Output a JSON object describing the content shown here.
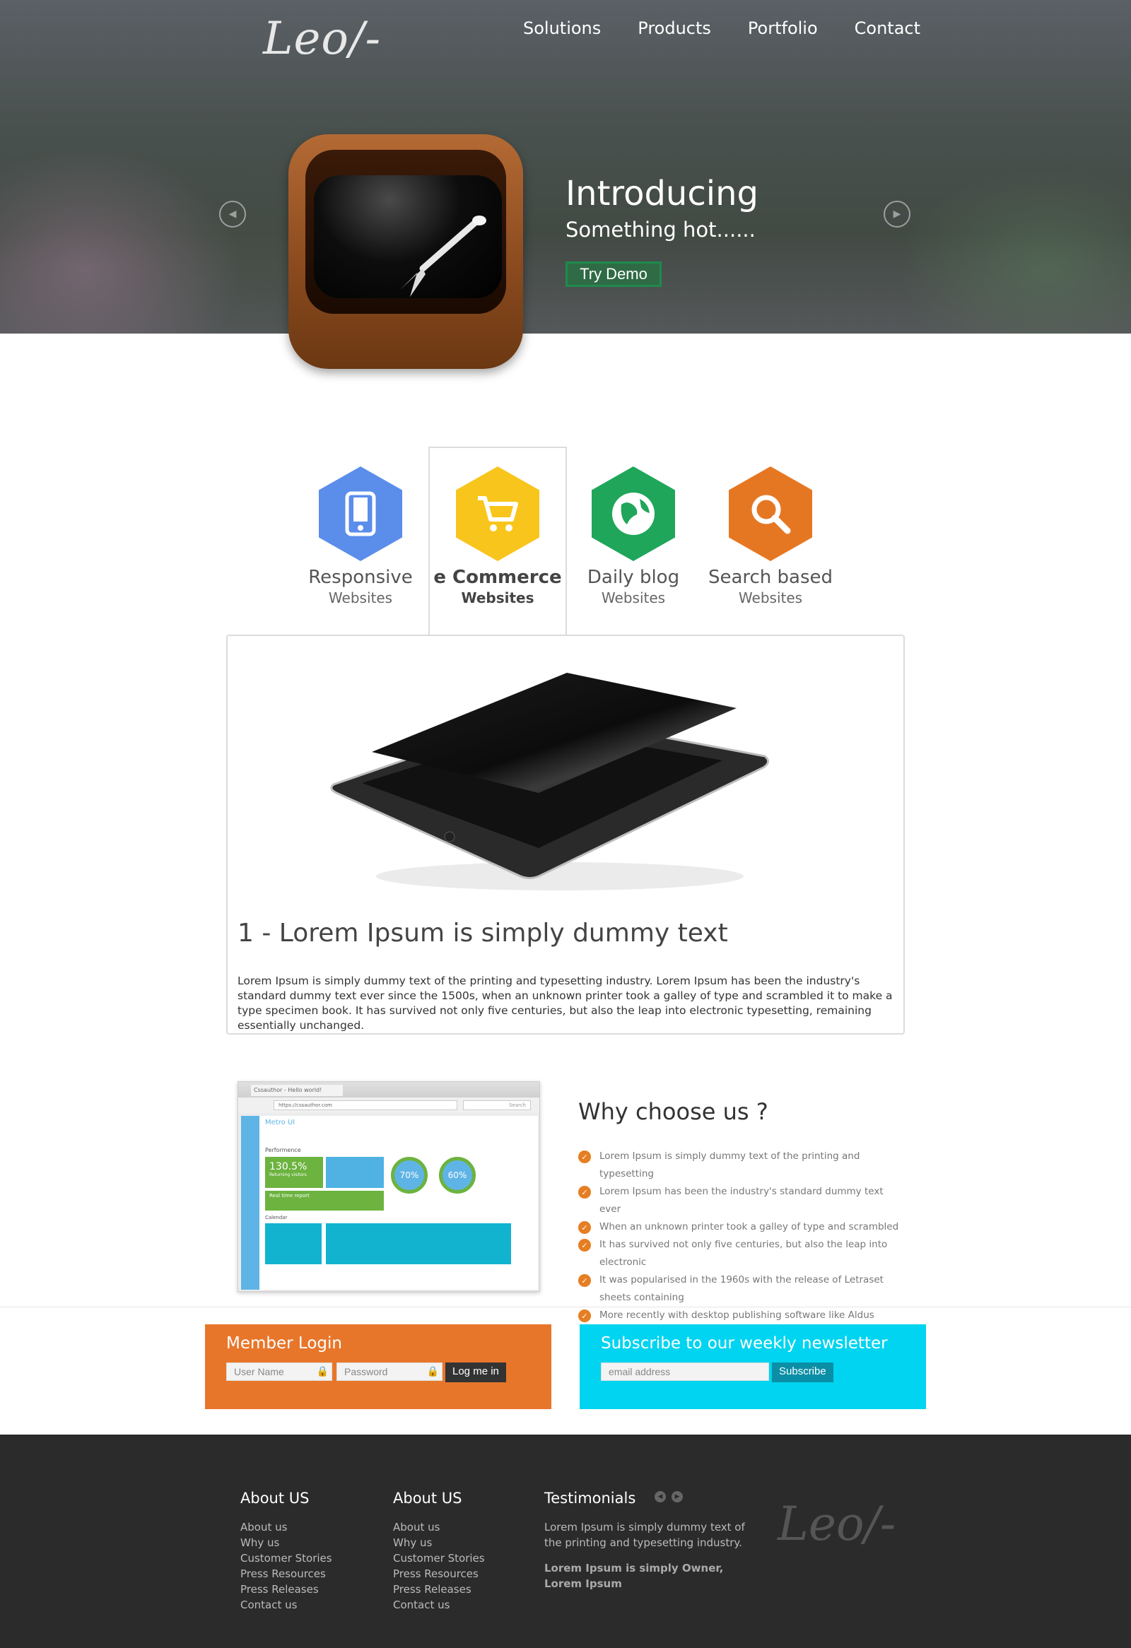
{
  "header": {
    "logo": "Leo/-",
    "nav": [
      "Solutions",
      "Products",
      "Portfolio",
      "Contact"
    ]
  },
  "hero": {
    "title": "Introducing",
    "subtitle": "Something hot......",
    "cta": "Try Demo",
    "prev_icon": "chevron-left-icon",
    "next_icon": "chevron-right-icon"
  },
  "features": [
    {
      "title": "Responsive",
      "sub": "Websites",
      "color": "#5b8dea",
      "icon": "mobile-icon"
    },
    {
      "title": "e Commerce",
      "sub": "Websites",
      "color": "#f8c51c",
      "icon": "cart-icon"
    },
    {
      "title": "Daily blog",
      "sub": "Websites",
      "color": "#1fa65a",
      "icon": "globe-icon"
    },
    {
      "title": "Search based",
      "sub": "Websites",
      "color": "#e67722",
      "icon": "search-icon"
    }
  ],
  "panel": {
    "title": "1 - Lorem Ipsum is simply dummy text",
    "text": "Lorem Ipsum is simply dummy text of the printing and typesetting industry. Lorem Ipsum has been the industry's standard dummy text ever since the 1500s, when an unknown printer took a galley of type and scrambled it to make a type specimen book. It has survived not only five centuries, but also the leap into electronic typesetting, remaining essentially unchanged."
  },
  "why": {
    "title": "Why choose us ?",
    "items": [
      "Lorem Ipsum is simply dummy text of the printing and typesetting",
      "Lorem Ipsum has been the industry's standard dummy text ever",
      "When an unknown printer took a galley of type and scrambled",
      "It has survived not only five centuries, but also the leap into electronic",
      "It was popularised in the 1960s with the release of Letraset sheets containing",
      "More recently with desktop publishing software like Aldus PageMaker"
    ],
    "browser": {
      "tab": "Cssauthor - Hello world!",
      "url": "https://cssauthor.com",
      "search": "Search",
      "app": "Metro UI",
      "section": "Performence",
      "stat": "130.5%",
      "stat_label": "Returning visitors",
      "ring1": "70%",
      "ring2": "60%",
      "report": "Real time report",
      "calendar": "Calendar"
    }
  },
  "login": {
    "title": "Member Login",
    "user_placeholder": "User Name",
    "pass_placeholder": "Password",
    "button": "Log me in"
  },
  "newsletter": {
    "title": "Subscribe to our weekly newsletter",
    "email_placeholder": "email address",
    "button": "Subscribe"
  },
  "footer": {
    "col1": {
      "title": "About US",
      "links": [
        "About us",
        "Why us",
        "Customer Stories",
        "Press Resources",
        "Press Releases",
        "Contact us"
      ]
    },
    "col2": {
      "title": "About US",
      "links": [
        "About us",
        "Why us",
        "Customer Stories",
        "Press Resources",
        "Press Releases",
        "Contact us"
      ]
    },
    "testimonials": {
      "title": "Testimonials",
      "text": "Lorem Ipsum is simply dummy text of the printing and typesetting industry.",
      "owner": "Lorem Ipsum is simply Owner, Lorem Ipsum"
    },
    "logo": "Leo/-"
  }
}
